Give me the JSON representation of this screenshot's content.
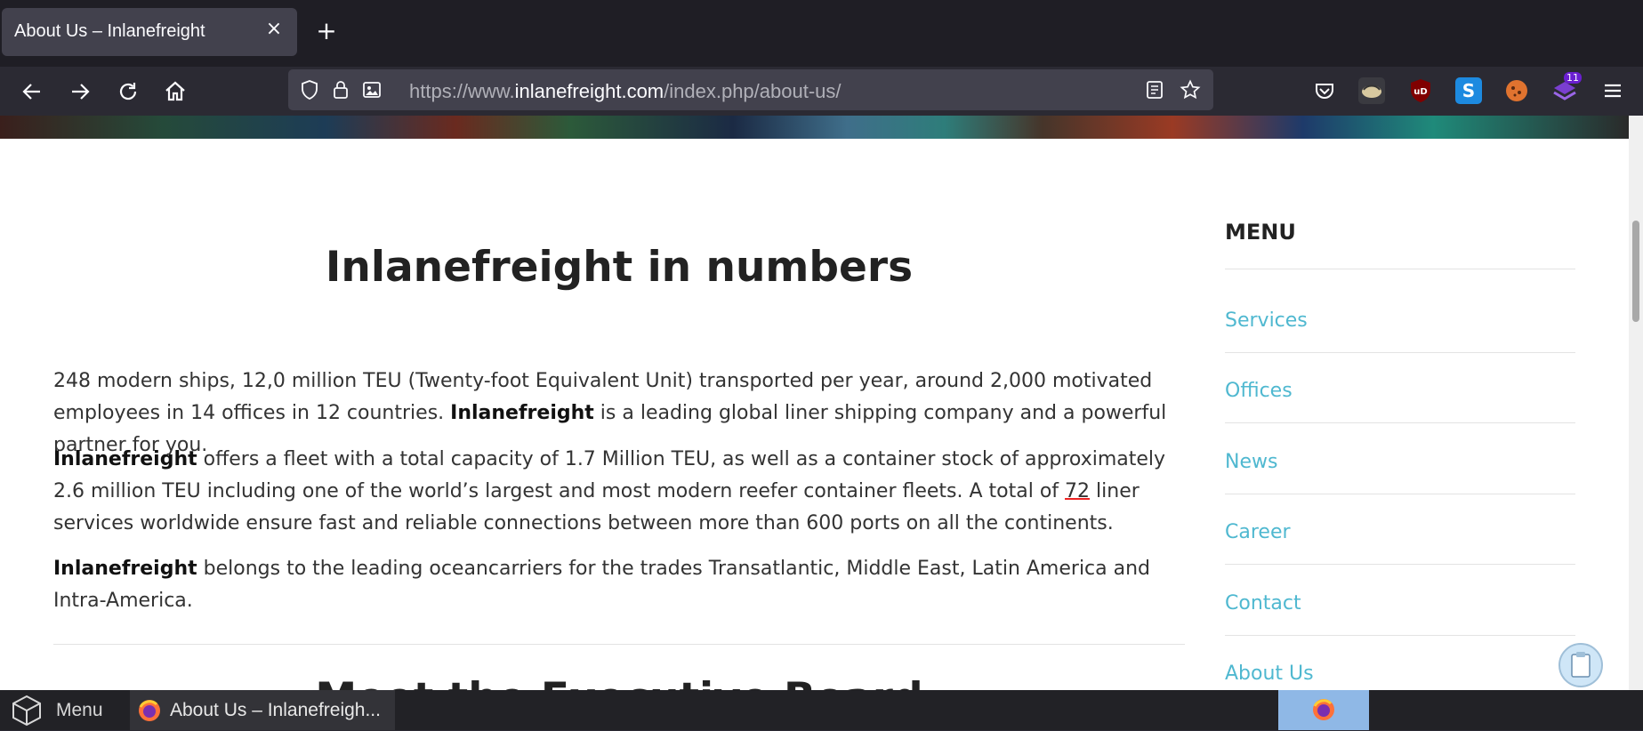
{
  "browser": {
    "tab_title": "About Us – Inlanefreight",
    "tab_close": "×",
    "new_tab": "+",
    "url_prefix": "https://www.",
    "url_domain": "inlanefreight.com",
    "url_path": "/index.php/about-us/",
    "extension_badge": "11"
  },
  "page": {
    "title": "Inlanefreight in numbers",
    "para1": {
      "text_a": "248 modern ships, 12,0 million TEU (Twenty-foot Equivalent Unit) transported per year, around 2,000 motivated employees in 14 offices in 12 countries. ",
      "bold": "Inlanefreight",
      "text_b": " is a leading global liner shipping company and a powerful partner for you."
    },
    "para2": {
      "bold": "Inlanefreight",
      "text_a": " offers a fleet with a total capacity of 1.7 Million TEU, as well as a container stock of approximately 2.6 million TEU including one of the world’s largest and most modern reefer container fleets. A total of ",
      "number": "72",
      "text_b": " liner services worldwide ensure fast and reliable connections between more than 600 ports on all the continents."
    },
    "para3": {
      "bold": "Inlanefreight",
      "text_a": " belongs to the leading oceancarriers for the trades Transatlantic, Middle East, Latin America and Intra-America."
    },
    "next_title": "Meet the Executive Board"
  },
  "sidebar": {
    "heading": "MENU",
    "links": [
      "Services",
      "Offices",
      "News",
      "Career",
      "Contact",
      "About Us"
    ]
  },
  "taskbar": {
    "menu_label": "Menu",
    "active_window": "About Us – Inlanefreigh..."
  },
  "colors": {
    "link": "#4fb8d0",
    "chrome_dark": "#1f1e25",
    "chrome": "#2b2a33"
  }
}
